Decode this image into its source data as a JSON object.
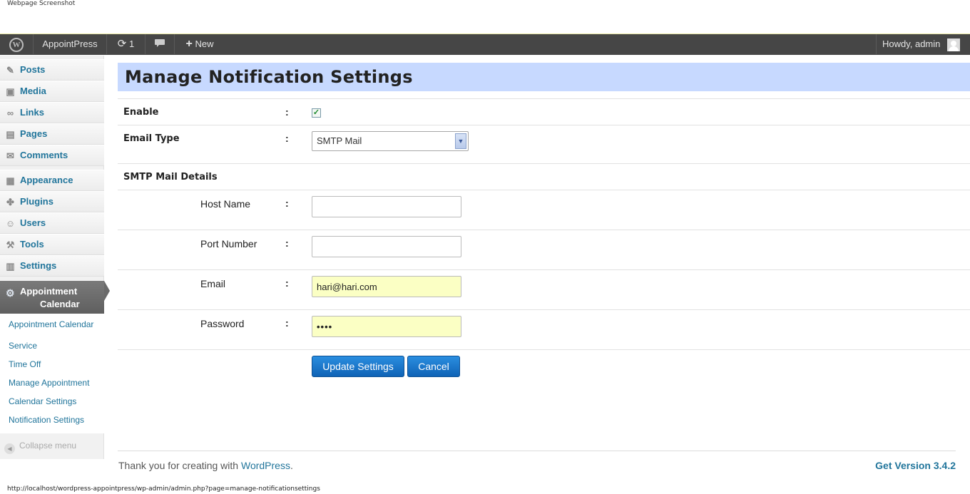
{
  "screenshot_caption": "Webpage Screenshot",
  "admin_bar": {
    "logo_glyph": "W",
    "site_name": "AppointPress",
    "updates_count": "1",
    "new_label": "New",
    "howdy": "Howdy, admin"
  },
  "sidebar": {
    "items": [
      {
        "label": "Posts",
        "icon": "pushpin-icon",
        "glyph": "✎"
      },
      {
        "label": "Media",
        "icon": "media-icon",
        "glyph": "▣"
      },
      {
        "label": "Links",
        "icon": "link-icon",
        "glyph": "∞"
      },
      {
        "label": "Pages",
        "icon": "pages-icon",
        "glyph": "▤"
      },
      {
        "label": "Comments",
        "icon": "comment-icon",
        "glyph": "✉"
      },
      {
        "label": "Appearance",
        "icon": "appearance-icon",
        "glyph": "▦"
      },
      {
        "label": "Plugins",
        "icon": "plugin-icon",
        "glyph": "✤"
      },
      {
        "label": "Users",
        "icon": "users-icon",
        "glyph": "☺"
      },
      {
        "label": "Tools",
        "icon": "tools-icon",
        "glyph": "⚒"
      },
      {
        "label": "Settings",
        "icon": "settings-icon",
        "glyph": "▥"
      }
    ],
    "active": {
      "line1": "Appointment",
      "line2": "Calendar",
      "icon": "gear-icon",
      "glyph": "⚙"
    },
    "submenu": [
      "Appointment Calendar",
      "Service",
      "Time Off",
      "Manage Appointment",
      "Calendar Settings",
      "Notification Settings"
    ],
    "collapse_label": "Collapse menu"
  },
  "main": {
    "title": "Manage Notification Settings",
    "colon": ":",
    "enable_label": "Enable",
    "enable_checked": true,
    "email_type_label": "Email Type",
    "email_type_value": "SMTP Mail",
    "smtp_section_label": "SMTP Mail Details",
    "host_label": "Host Name",
    "host_value": "",
    "port_label": "Port Number",
    "port_value": "",
    "email_label": "Email",
    "email_value": "hari@hari.com",
    "password_label": "Password",
    "password_value": "••••",
    "update_button": "Update Settings",
    "cancel_button": "Cancel"
  },
  "footer": {
    "thanks_prefix": "Thank you for creating with ",
    "thanks_link": "WordPress",
    "thanks_suffix": ".",
    "version": "Get Version 3.4.2"
  },
  "status_url": "http://localhost/wordpress-appointpress/wp-admin/admin.php?page=manage-notificationsettings",
  "colors": {
    "admin_bar": "#464646",
    "title_bg": "#c7d9ff",
    "link": "#21759b",
    "button": "#1a76cc",
    "autofill": "#fbffc4"
  }
}
